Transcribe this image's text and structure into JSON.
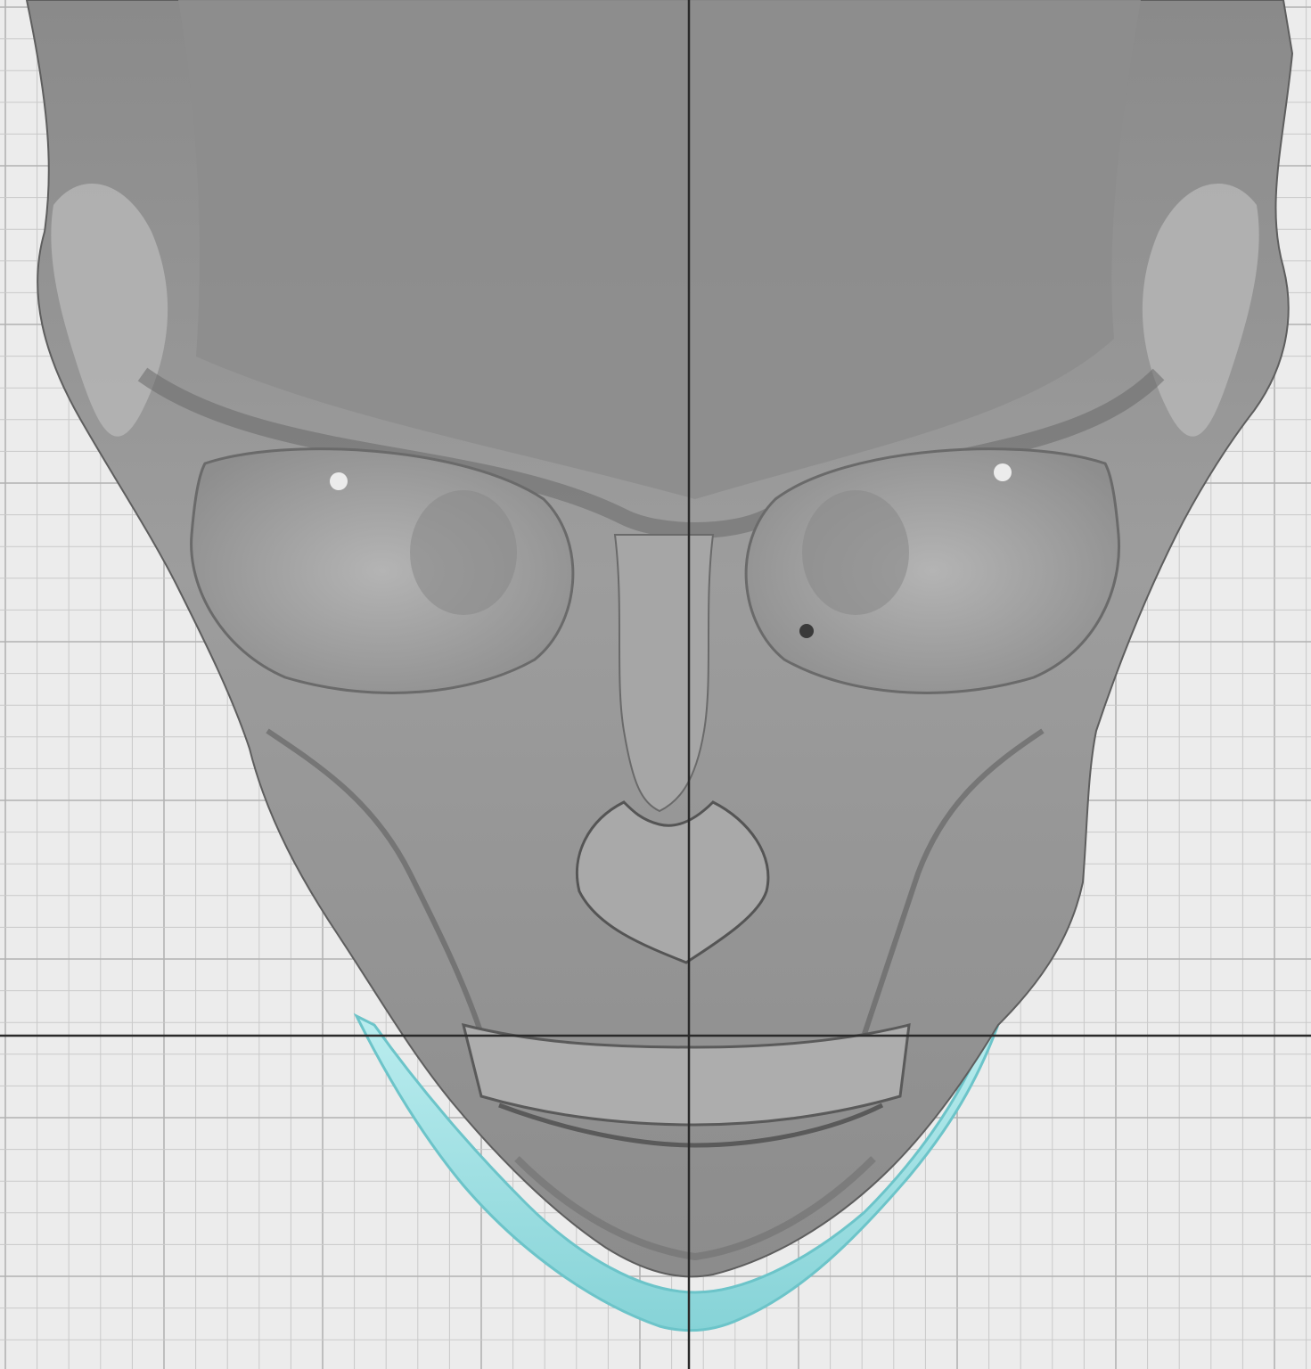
{
  "viewport": {
    "background_color": "#ececec",
    "grid_minor_color": "#c9c9c9",
    "grid_major_color": "#b2b2b2",
    "crosshair_color": "#2a2a2a",
    "bone_color": "#9a9a9a",
    "bone_shadow_color": "#6a6a6a",
    "bone_highlight_color": "#c8c8c8",
    "implant_color": "#9fe0e3",
    "implant_edge_color": "#6cc4c9"
  },
  "model": {
    "skull": "skull-3d-model",
    "implant": "jaw-angle-implant"
  }
}
